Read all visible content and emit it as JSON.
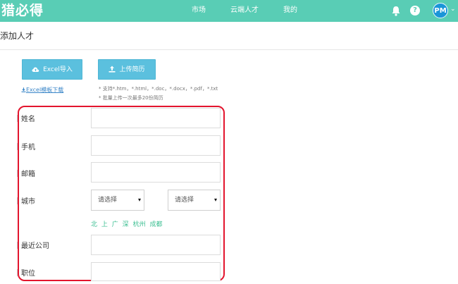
{
  "header": {
    "logo": "猎必得",
    "nav": [
      "市场",
      "云端人才",
      "我的"
    ],
    "avatar_initials": "PM",
    "bell_icon": "bell-icon",
    "help_icon": "help-icon",
    "help_glyph": "?",
    "avatar_caret": "⌄",
    "accent_color": "#59cdb5"
  },
  "page": {
    "title": "添加人才"
  },
  "toolbar": {
    "excel_import_label": "Excel导入",
    "upload_resume_label": "上传简历",
    "excel_template_link": "Excel模板下载",
    "hint_formats": "* 支持*.htm，*.html，*.doc，*.docx，*.pdf，*.txt",
    "hint_limit": "* 批量上传一次最多20份简历",
    "button_color": "#5bc0de"
  },
  "form": {
    "name_label": "姓名",
    "phone_label": "手机",
    "email_label": "邮箱",
    "city_label": "城市",
    "province_placeholder": "请选择",
    "city_placeholder": "请选择",
    "select_caret": "▾",
    "quick_cities": [
      "北",
      "上",
      "广",
      "深",
      "杭州",
      "成都"
    ],
    "company_label": "最近公司",
    "position_label": "职位",
    "quick_city_color": "#3cbf92",
    "highlight_border_color": "#e3142d"
  }
}
